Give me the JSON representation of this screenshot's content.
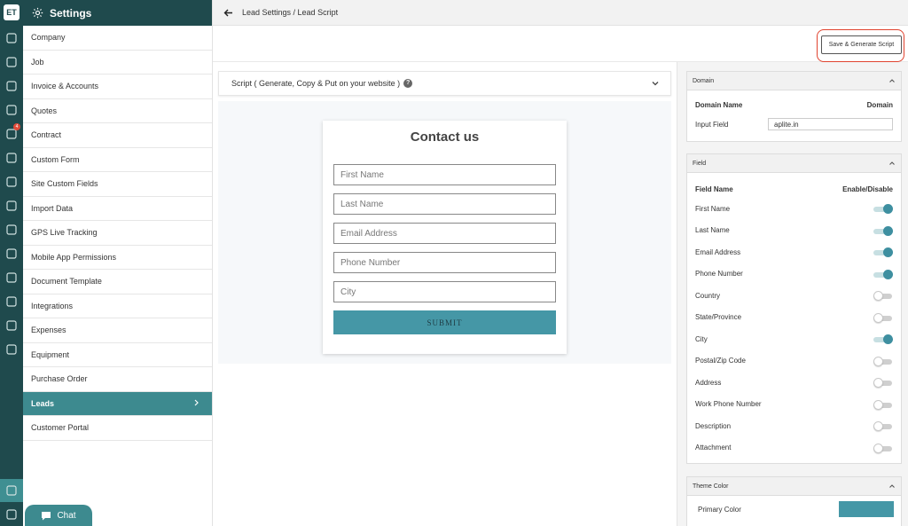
{
  "rail": {
    "logo": "ET",
    "badge_count": "4",
    "icons": [
      "dashboard-icon",
      "navigation-icon",
      "calendar-icon",
      "user-search-icon",
      "briefcase-icon",
      "person-icon",
      "dollar-icon",
      "document-list-icon",
      "handshake-icon",
      "team-icon",
      "tools-icon",
      "thumbs-up-icon",
      "spreadsheet-icon",
      "bar-chart-icon",
      "settings-doc-icon",
      "logout-icon"
    ]
  },
  "sidebar": {
    "title": "Settings",
    "items": [
      {
        "label": "Company"
      },
      {
        "label": "Job"
      },
      {
        "label": "Invoice & Accounts"
      },
      {
        "label": "Quotes"
      },
      {
        "label": "Contract"
      },
      {
        "label": "Custom Form"
      },
      {
        "label": "Site Custom Fields"
      },
      {
        "label": "Import Data"
      },
      {
        "label": "GPS Live Tracking"
      },
      {
        "label": "Mobile App Permissions"
      },
      {
        "label": "Document Template"
      },
      {
        "label": "Integrations"
      },
      {
        "label": "Expenses"
      },
      {
        "label": "Equipment"
      },
      {
        "label": "Purchase Order"
      },
      {
        "label": "Leads",
        "active": true
      },
      {
        "label": "Customer Portal"
      }
    ],
    "chat_label": "Chat"
  },
  "header": {
    "breadcrumb": "Lead Settings /  Lead Script",
    "save_label": "Save & Generate Script"
  },
  "main": {
    "accordion_label": "Script ( Generate, Copy & Put on your website )",
    "help_glyph": "?",
    "form": {
      "title": "Contact us",
      "fields": [
        "First Name",
        "Last Name",
        "Email Address",
        "Phone Number",
        "City"
      ],
      "submit_label": "SUBMIT"
    }
  },
  "right": {
    "domain": {
      "title": "Domain",
      "col1": "Domain Name",
      "col2": "Domain",
      "input_label": "Input Field",
      "input_value": "aplite.in"
    },
    "field": {
      "title": "Field",
      "col1": "Field Name",
      "col2": "Enable/Disable",
      "rows": [
        {
          "name": "First Name",
          "enabled": true
        },
        {
          "name": "Last Name",
          "enabled": true
        },
        {
          "name": "Email Address",
          "enabled": true
        },
        {
          "name": "Phone Number",
          "enabled": true
        },
        {
          "name": "Country",
          "enabled": false
        },
        {
          "name": "State/Province",
          "enabled": false
        },
        {
          "name": "City",
          "enabled": true
        },
        {
          "name": "Postal/Zip Code",
          "enabled": false
        },
        {
          "name": "Address",
          "enabled": false
        },
        {
          "name": "Work Phone Number",
          "enabled": false
        },
        {
          "name": "Description",
          "enabled": false
        },
        {
          "name": "Attachment",
          "enabled": false
        }
      ]
    },
    "theme": {
      "title": "Theme Color",
      "primary_label": "Primary Color",
      "primary_color": "#4597a6"
    }
  },
  "colors": {
    "brand_dark": "#1f4a4d",
    "accent": "#3d8a8f",
    "highlight": "#e0432f"
  }
}
